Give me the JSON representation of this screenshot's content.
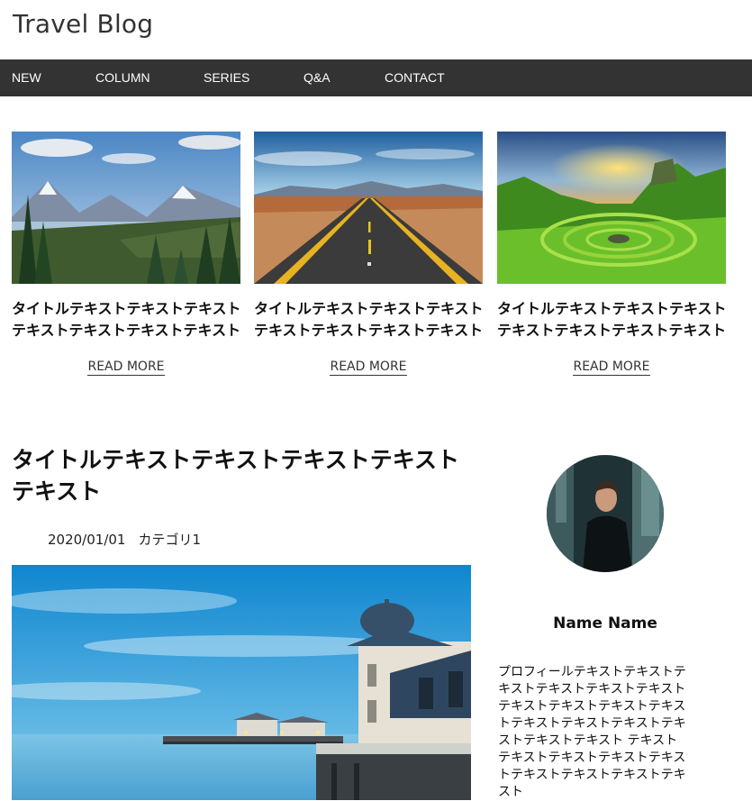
{
  "site": {
    "title": "Travel Blog"
  },
  "nav": {
    "items": [
      "NEW",
      "COLUMN",
      "SERIES",
      "Q&A",
      "CONTACT"
    ]
  },
  "cards": [
    {
      "title_line1": "タイトルテキストテキストテキスト",
      "title_line2": "テキストテキストテキストテキスト",
      "read_more": "READ MORE",
      "image": "mountain-forest-landscape"
    },
    {
      "title_line1": "タイトルテキストテキストテキスト",
      "title_line2": "テキストテキストテキストテキスト",
      "read_more": "READ MORE",
      "image": "desert-road"
    },
    {
      "title_line1": "タイトルテキストテキストテキスト",
      "title_line2": "テキストテキストテキストテキスト",
      "read_more": "READ MORE",
      "image": "green-spiral-hills-sunset"
    }
  ],
  "post": {
    "title": "タイトルテキストテキストテキストテキストテキスト",
    "date": "2020/01/01",
    "category": "カテゴリ1",
    "image": "pier-at-dusk"
  },
  "profile": {
    "name": "Name Name",
    "text": "プロフィールテキストテキストテキストテキストテキストテキストテキストテキストテキストテキストテキストテキストテキストテキストテキストテキスト テキストテキストテキストテキストテキストテキストテキストテキストテキスト",
    "avatar": "man-in-black-hoodie"
  },
  "colors": {
    "nav_bg": "#333333",
    "nav_text": "#ffffff"
  }
}
